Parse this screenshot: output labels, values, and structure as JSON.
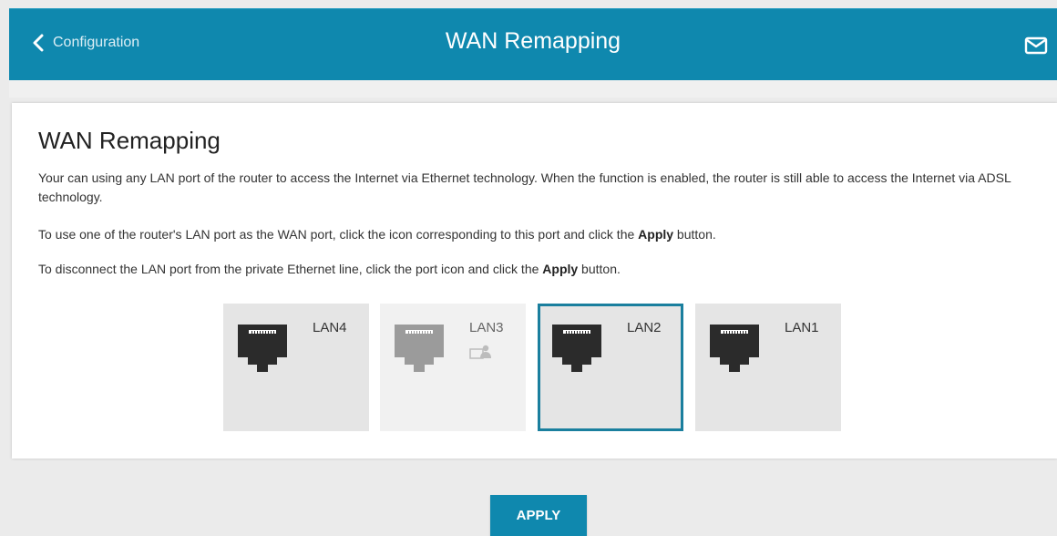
{
  "header": {
    "back_label": "Configuration",
    "title": "WAN Remapping",
    "mail_icon": "mail-icon",
    "accent_color": "#0f88ae"
  },
  "section": {
    "heading": "WAN Remapping",
    "para1": "Your can using any LAN port of the router to access the Internet via Ethernet technology. When the function is enabled, the router is still able to access the Internet via ADSL technology.",
    "para2_pre": "To use one of the router's LAN port as the WAN port, click the icon corresponding to this port and click the ",
    "para2_bold": "Apply",
    "para2_post": " button.",
    "para3_pre": "To disconnect the LAN port from the private Ethernet line, click the port icon and click the ",
    "para3_bold": "Apply",
    "para3_post": " button."
  },
  "ports": [
    {
      "label": "LAN4",
      "state": "normal",
      "icon": "ethernet-port-icon"
    },
    {
      "label": "LAN3",
      "state": "disabled-in-use",
      "icon": "ethernet-port-icon",
      "badge_icon": "computer-icon"
    },
    {
      "label": "LAN2",
      "state": "selected",
      "icon": "ethernet-port-icon"
    },
    {
      "label": "LAN1",
      "state": "normal",
      "icon": "ethernet-port-icon"
    }
  ],
  "apply_label": "APPLY"
}
